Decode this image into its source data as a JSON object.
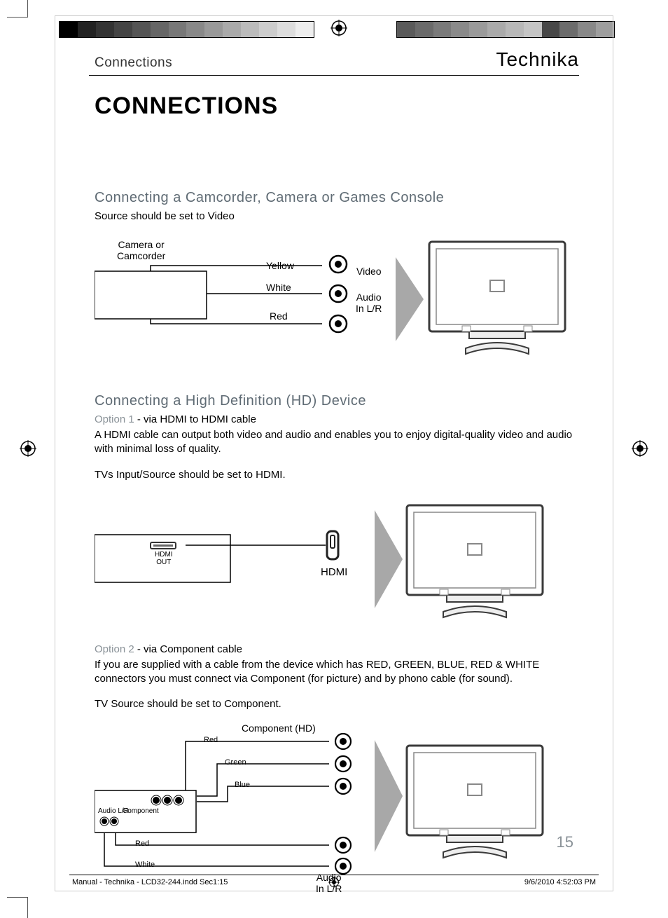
{
  "header": {
    "sectionLabel": "Connections",
    "brand": "Technika"
  },
  "title": "CONNECTIONS",
  "s1": {
    "head": "Connecting a Camcorder, Camera or Games Console",
    "sub": "Source should be set to Video",
    "deviceLabel": "Camera or\nCamcorder",
    "yellow": "Yellow",
    "white": "White",
    "red": "Red",
    "videoLbl": "Video",
    "audioLbl": "Audio\nIn L/R"
  },
  "s2": {
    "head": "Connecting a High Definition (HD) Device",
    "opt1prefix": "Option 1 ",
    "opt1rest": "- via HDMI to HDMI cable",
    "body1": "A HDMI cable can output both video and audio and enables you to enjoy digital-quality video and audio with minimal loss of quality.",
    "body2": "TVs Input/Source should be set to HDMI.",
    "hdmiOut": "HDMI\nOUT",
    "hdmiLbl": "HDMI",
    "opt2prefix": "Option 2 ",
    "opt2rest": "- via Component cable",
    "body3": "If you are supplied with a cable from the device which has RED, GREEN, BLUE, RED & WHITE connectors you must connect via Component (for picture) and by phono cable (for sound).",
    "body4": "TV Source should be set to Component.",
    "compHead": "Component (HD)",
    "red": "Red",
    "green": "Green",
    "blue": "Blue",
    "white": "White",
    "audioLR": "Audio L/R",
    "component": "Component",
    "audioInLR": "Audio\nIn L/R"
  },
  "pageNumber": "15",
  "footer": {
    "left": "Manual - Technika - LCD32-244.indd   Sec1:15",
    "right": "9/6/2010   4:52:03 PM"
  }
}
